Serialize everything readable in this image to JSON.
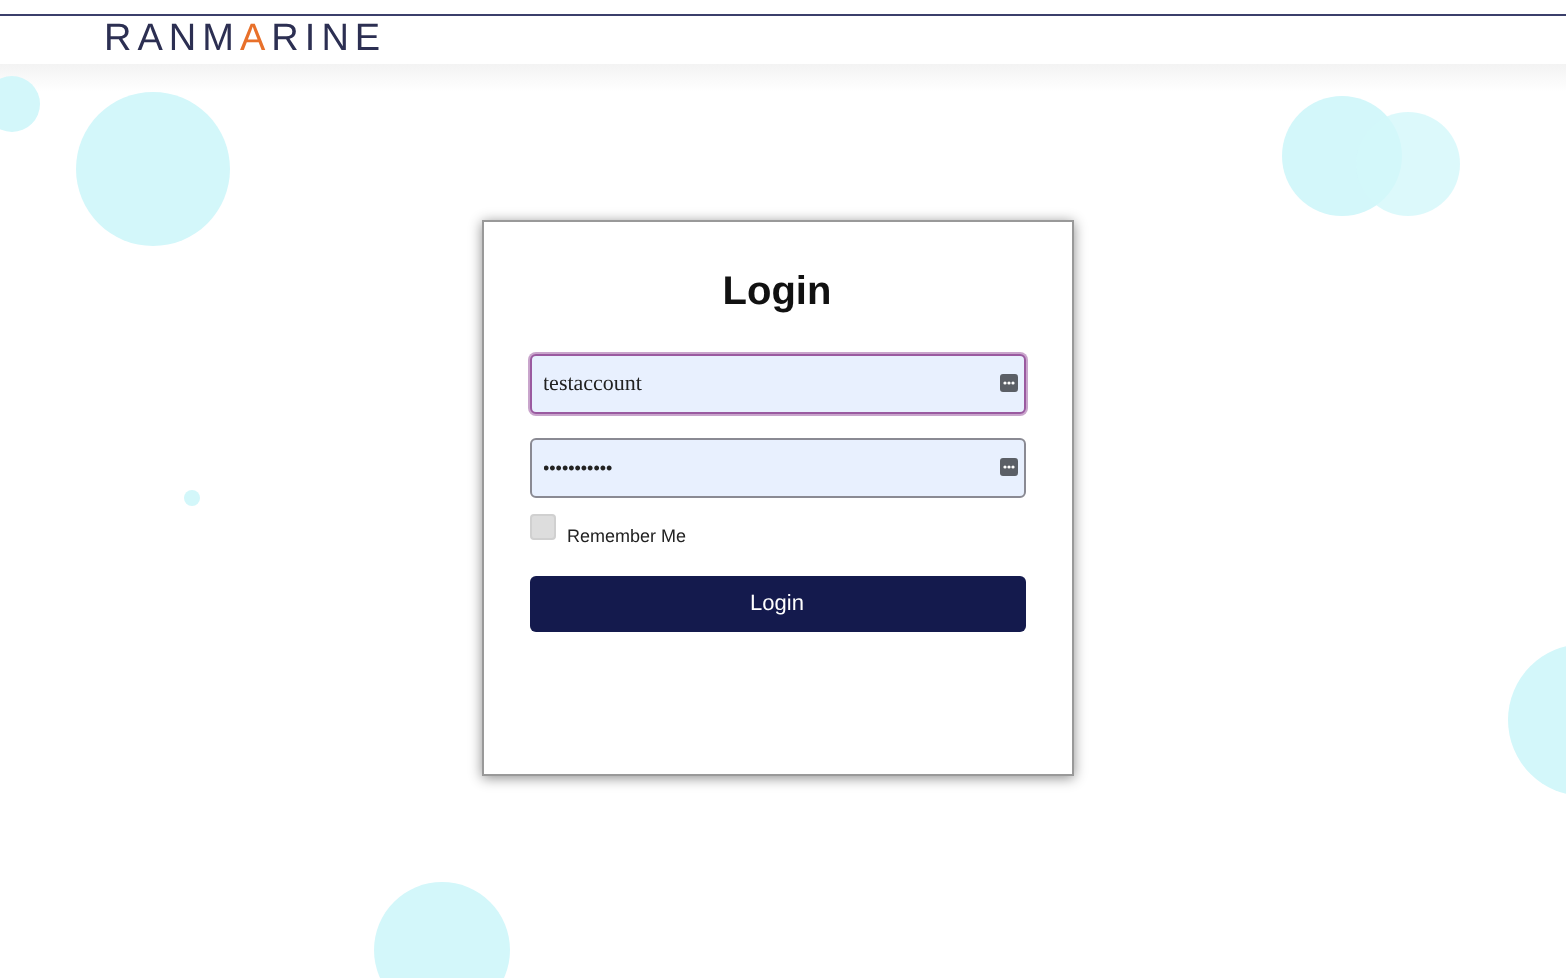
{
  "header": {
    "logo": "RANMARINE"
  },
  "login_card": {
    "title": "Login",
    "fields": [
      {
        "kind": "text",
        "value": "testaccount",
        "focused": true
      },
      {
        "kind": "password",
        "value": "•••••••••••",
        "focused": false
      }
    ],
    "remember_me": {
      "label": "Remember Me",
      "checked": false
    },
    "submit": "Login"
  }
}
